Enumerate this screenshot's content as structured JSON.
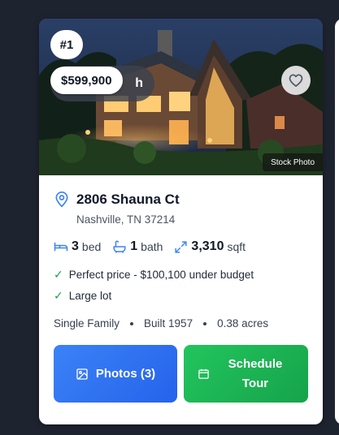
{
  "listing": {
    "rank": "#1",
    "price": "$599,900",
    "price_under": "h",
    "stock_label": "Stock Photo",
    "street": "2806 Shauna Ct",
    "city": "Nashville, TN 37214",
    "beds_value": "3",
    "beds_unit": "bed",
    "baths_value": "1",
    "baths_unit": "bath",
    "sqft_value": "3,310",
    "sqft_unit": "sqft",
    "perks": [
      "Perfect price - $100,100 under budget",
      "Large lot"
    ],
    "type": "Single Family",
    "built": "Built 1957",
    "lot": "0.38 acres"
  },
  "buttons": {
    "photos_label": "Photos (3)",
    "tour_label": "Schedule Tour"
  },
  "icons": {
    "favorite": "heart-icon",
    "location": "map-pin-icon",
    "beds": "bed-icon",
    "baths": "bath-icon",
    "sqft": "expand-icon",
    "photos": "image-icon",
    "tour": "calendar-icon"
  },
  "colors": {
    "background": "#1e2330",
    "accent_blue": "#2563eb",
    "accent_green": "#16a34a",
    "check_green": "#16a34a"
  }
}
